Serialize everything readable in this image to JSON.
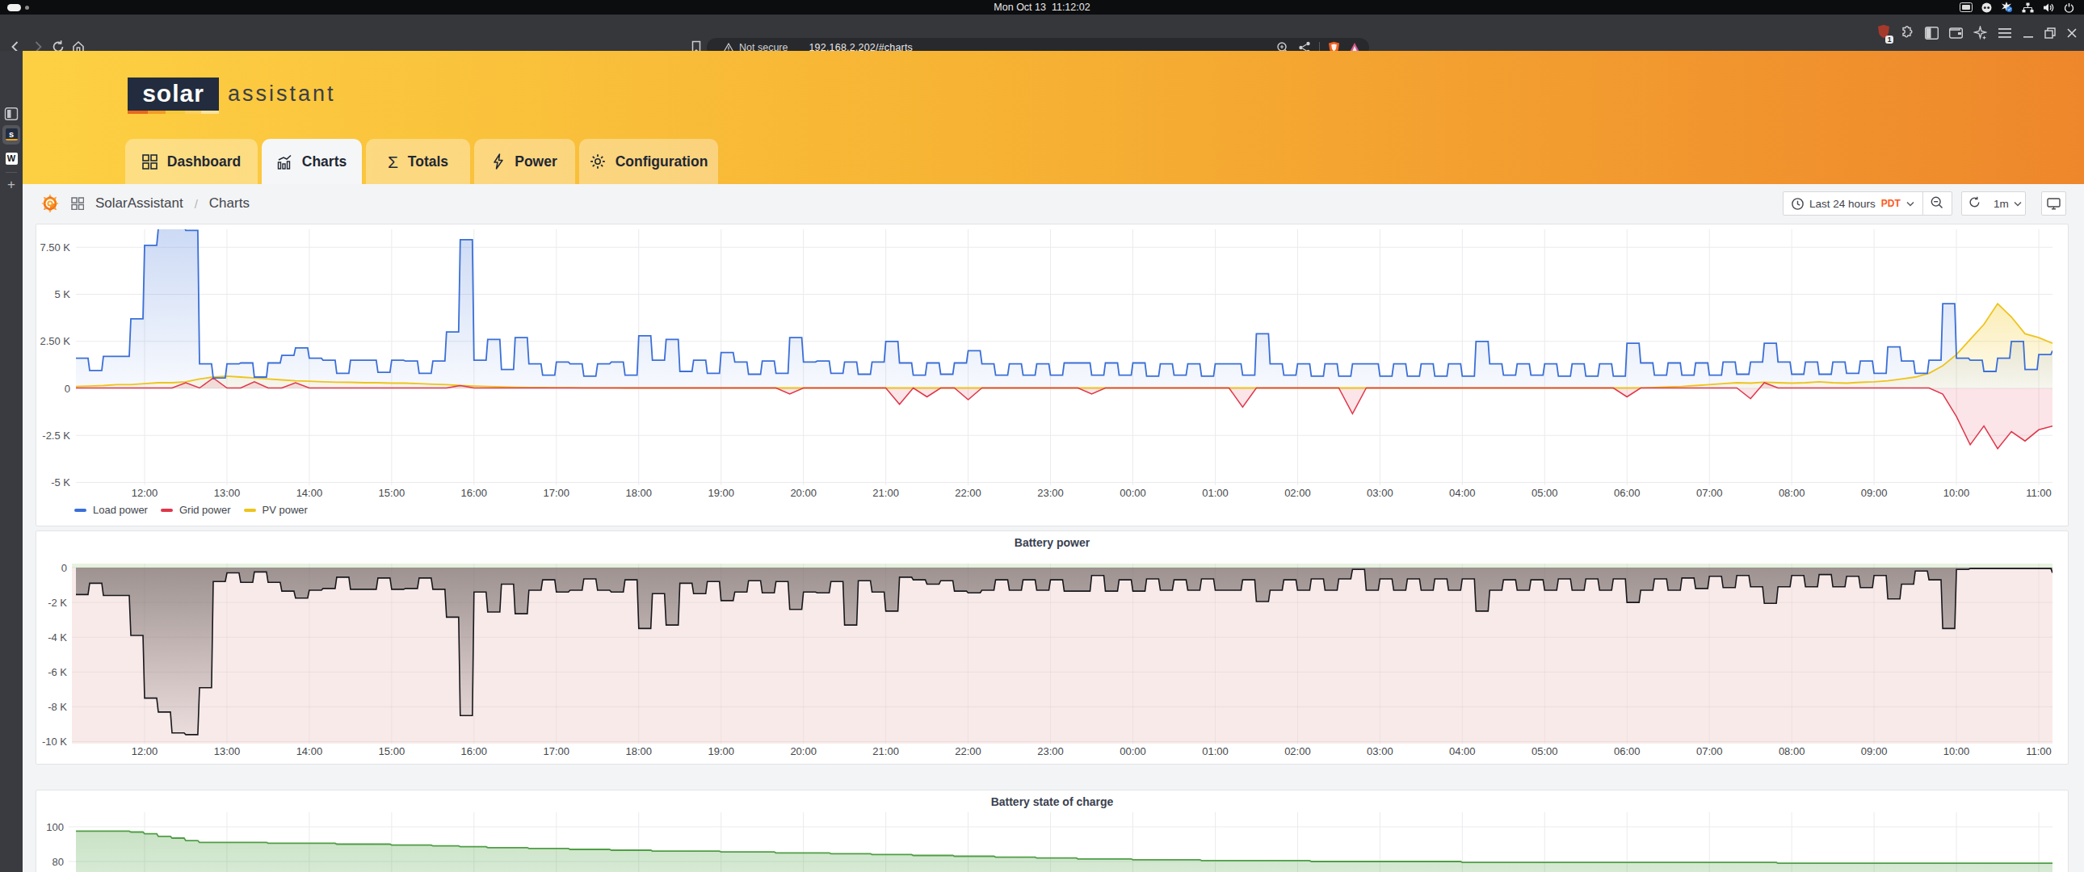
{
  "system_bar": {
    "clock": "Mon Oct 13  11:12:02",
    "tray_icons": [
      "tablet-mode-icon",
      "screencast-icon",
      "input-source-icon",
      "network-wired-icon",
      "volume-icon",
      "power-icon"
    ]
  },
  "browser": {
    "security_label": "Not secure",
    "url": "192.168.2.202/#charts",
    "shield_badge": "1",
    "nav_icons": [
      "back",
      "forward",
      "reload",
      "home"
    ],
    "window_controls": [
      "minimize",
      "maximize",
      "close"
    ]
  },
  "browser_sidebar": {
    "tabs": [
      "solarassistant-tab",
      "wikipedia-tab"
    ],
    "add_label": "+"
  },
  "app": {
    "logo_primary": "solar",
    "logo_secondary": "assistant",
    "logo_strip_colors": [
      "#e8681b",
      "#f29b23",
      "#f6c937",
      "#fbe39b"
    ],
    "tabs": [
      {
        "label": "Dashboard",
        "icon": "grid-icon",
        "active": false
      },
      {
        "label": "Charts",
        "icon": "chart-icon",
        "active": true
      },
      {
        "label": "Totals",
        "icon": "sigma-icon",
        "active": false
      },
      {
        "label": "Power",
        "icon": "lightning-icon",
        "active": false
      },
      {
        "label": "Configuration",
        "icon": "gear-icon",
        "active": false
      }
    ]
  },
  "grafana": {
    "breadcrumb": {
      "root": "SolarAssistant",
      "separator": "/",
      "current": "Charts"
    },
    "toolbar": {
      "time_range": "Last 24 hours",
      "timezone": "PDT",
      "refresh_interval": "1m"
    }
  },
  "chart_data": [
    {
      "type": "area",
      "title": "",
      "unit": "kW",
      "interval_minutes": 10,
      "x_start_clock": "11:10",
      "x_tick_labels": [
        "12:00",
        "13:00",
        "14:00",
        "15:00",
        "16:00",
        "17:00",
        "18:00",
        "19:00",
        "20:00",
        "21:00",
        "22:00",
        "23:00",
        "00:00",
        "01:00",
        "02:00",
        "03:00",
        "04:00",
        "05:00",
        "06:00",
        "07:00",
        "08:00",
        "09:00",
        "10:00",
        "11:00"
      ],
      "y_ticks": [
        {
          "label": "7.50 K",
          "value": 7.5
        },
        {
          "label": "5 K",
          "value": 5
        },
        {
          "label": "2.50 K",
          "value": 2.5
        },
        {
          "label": "0",
          "value": 0
        },
        {
          "label": "-2.5 K",
          "value": -2.5
        },
        {
          "label": "-5 K",
          "value": -5
        }
      ],
      "ylim": [
        -5.6,
        8.45
      ],
      "legend_position": "bottom",
      "series": [
        {
          "name": "Load power",
          "color": "#3a6fd8",
          "fill_from": 0.28,
          "fill_to": 0.05,
          "step": true,
          "values": [
            1.6,
            0.95,
            1.7,
            1.7,
            3.7,
            7.6,
            8.5,
            8.6,
            8.4,
            1.3,
            0.55,
            1.3,
            1.35,
            0.6,
            1.35,
            1.75,
            2.15,
            1.6,
            1.5,
            0.8,
            1.5,
            1.5,
            0.85,
            1.5,
            1.45,
            0.8,
            1.45,
            3.0,
            7.9,
            1.5,
            2.6,
            1.0,
            2.7,
            1.3,
            0.7,
            1.4,
            1.3,
            0.65,
            1.3,
            1.4,
            0.7,
            2.8,
            1.5,
            2.6,
            0.9,
            1.5,
            0.8,
            1.9,
            1.4,
            0.75,
            1.45,
            0.8,
            2.7,
            1.4,
            1.45,
            0.8,
            1.4,
            0.75,
            1.4,
            2.5,
            1.35,
            0.7,
            1.35,
            0.75,
            1.35,
            2.0,
            1.3,
            0.7,
            1.3,
            0.7,
            1.3,
            0.7,
            1.35,
            1.35,
            0.7,
            1.35,
            0.7,
            1.35,
            0.65,
            1.3,
            0.7,
            1.3,
            0.65,
            1.3,
            1.3,
            0.7,
            2.9,
            1.3,
            0.7,
            1.3,
            0.65,
            1.3,
            0.65,
            1.3,
            1.3,
            0.65,
            1.3,
            0.65,
            1.3,
            0.65,
            1.3,
            0.65,
            2.5,
            1.3,
            0.7,
            1.3,
            0.7,
            1.3,
            0.65,
            1.3,
            0.65,
            1.3,
            0.65,
            2.4,
            1.35,
            0.7,
            1.35,
            0.7,
            1.35,
            0.7,
            1.4,
            0.75,
            1.4,
            2.4,
            1.4,
            0.75,
            1.4,
            0.75,
            1.4,
            0.8,
            1.45,
            0.8,
            2.2,
            1.45,
            0.8,
            1.5,
            4.5,
            1.6,
            1.5,
            0.9,
            1.6,
            2.5,
            1.0,
            1.8,
            2.0
          ]
        },
        {
          "name": "Grid power",
          "color": "#e0364a",
          "fill_from": 0.14,
          "fill_to": 0.14,
          "step": false,
          "values": [
            0.02,
            0.02,
            0.02,
            0.02,
            0.02,
            0.02,
            0.02,
            0.02,
            0.3,
            0.02,
            0.55,
            0.02,
            0.02,
            0.35,
            0.02,
            0.02,
            0.3,
            0.02,
            0.02,
            0.02,
            0.02,
            0.02,
            0.02,
            0.02,
            0.02,
            0.02,
            0.02,
            0.02,
            0.15,
            0.02,
            0.02,
            0.02,
            0.02,
            0.02,
            0.02,
            0.02,
            0.02,
            0.02,
            0.02,
            0.02,
            0.02,
            0.02,
            0.02,
            0.02,
            0.02,
            0.02,
            0.02,
            0.02,
            0.02,
            0.02,
            0.02,
            0.02,
            -0.3,
            0.02,
            0.02,
            0.02,
            0.02,
            0.02,
            0.02,
            0.02,
            -0.85,
            0.02,
            -0.45,
            0.02,
            0.02,
            -0.6,
            0.02,
            0.02,
            0.02,
            0.02,
            0.02,
            0.02,
            0.02,
            0.02,
            -0.3,
            0.02,
            0.02,
            0.02,
            0.02,
            0.02,
            0.02,
            0.02,
            0.02,
            0.02,
            0.02,
            -1.0,
            0.02,
            0.02,
            0.02,
            0.02,
            0.02,
            0.02,
            0.02,
            -1.35,
            0.02,
            0.02,
            0.02,
            0.02,
            0.02,
            0.02,
            0.02,
            0.02,
            0.02,
            0.02,
            0.02,
            0.02,
            0.02,
            0.02,
            0.02,
            0.02,
            0.02,
            0.02,
            0.02,
            -0.45,
            0.02,
            0.02,
            0.02,
            0.02,
            0.02,
            0.02,
            0.02,
            0.02,
            -0.55,
            0.3,
            0.02,
            0.02,
            0.02,
            0.02,
            0.02,
            0.02,
            0.02,
            0.02,
            0.02,
            0.02,
            0.02,
            0.02,
            -0.3,
            -1.5,
            -3.0,
            -2.0,
            -3.2,
            -2.3,
            -2.8,
            -2.2,
            -2.0
          ]
        },
        {
          "name": "PV power",
          "color": "#eec41c",
          "fill_from": 0.3,
          "fill_to": 0.07,
          "step": false,
          "values": [
            0.1,
            0.12,
            0.15,
            0.2,
            0.2,
            0.25,
            0.3,
            0.3,
            0.35,
            0.5,
            0.6,
            0.65,
            0.6,
            0.55,
            0.5,
            0.45,
            0.4,
            0.38,
            0.35,
            0.33,
            0.32,
            0.3,
            0.3,
            0.28,
            0.28,
            0.25,
            0.22,
            0.2,
            0.15,
            0.12,
            0.1,
            0.08,
            0.06,
            0.05,
            0.05,
            0.04,
            0.04,
            0.03,
            0.03,
            0.03,
            0.02,
            0.02,
            0.02,
            0.02,
            0.02,
            0.02,
            0.02,
            0.02,
            0.02,
            0.02,
            0.02,
            0.02,
            0.02,
            0.02,
            0.02,
            0.02,
            0.02,
            0.02,
            0.02,
            0.02,
            0.02,
            0.02,
            0.02,
            0.02,
            0.02,
            0.02,
            0.02,
            0.02,
            0.02,
            0.02,
            0.02,
            0.02,
            0.02,
            0.02,
            0.02,
            0.02,
            0.02,
            0.02,
            0.02,
            0.02,
            0.02,
            0.02,
            0.02,
            0.02,
            0.02,
            0.02,
            0.02,
            0.02,
            0.02,
            0.02,
            0.02,
            0.02,
            0.02,
            0.02,
            0.02,
            0.02,
            0.02,
            0.02,
            0.02,
            0.02,
            0.02,
            0.02,
            0.02,
            0.02,
            0.02,
            0.02,
            0.02,
            0.02,
            0.02,
            0.02,
            0.02,
            0.02,
            0.02,
            0.02,
            0.03,
            0.05,
            0.08,
            0.1,
            0.15,
            0.2,
            0.25,
            0.3,
            0.28,
            0.33,
            0.3,
            0.28,
            0.3,
            0.35,
            0.3,
            0.28,
            0.32,
            0.35,
            0.4,
            0.5,
            0.6,
            0.8,
            1.2,
            1.8,
            2.6,
            3.4,
            4.5,
            3.8,
            2.9,
            2.7,
            2.4
          ]
        }
      ]
    },
    {
      "type": "area",
      "title": "Battery power",
      "unit": "kW",
      "interval_minutes": 10,
      "x_tick_labels": [
        "12:00",
        "13:00",
        "14:00",
        "15:00",
        "16:00",
        "17:00",
        "18:00",
        "19:00",
        "20:00",
        "21:00",
        "22:00",
        "23:00",
        "00:00",
        "01:00",
        "02:00",
        "03:00",
        "04:00",
        "05:00",
        "06:00",
        "07:00",
        "08:00",
        "09:00",
        "10:00",
        "11:00"
      ],
      "y_ticks": [
        {
          "label": "0",
          "value": 0
        },
        {
          "label": "-2 K",
          "value": -2
        },
        {
          "label": "-4 K",
          "value": -4
        },
        {
          "label": "-6 K",
          "value": -6
        },
        {
          "label": "-8 K",
          "value": -8
        },
        {
          "label": "-10 K",
          "value": -10
        }
      ],
      "ylim": [
        -10.3,
        0.25
      ],
      "series": [
        {
          "name": "Battery power",
          "color": "#17181c",
          "step": true,
          "values": [
            -1.55,
            -0.9,
            -1.6,
            -1.6,
            -3.9,
            -7.5,
            -8.3,
            -9.5,
            -9.6,
            -6.9,
            -0.8,
            -0.3,
            -0.85,
            -0.25,
            -0.85,
            -1.35,
            -1.75,
            -1.3,
            -1.2,
            -0.55,
            -1.25,
            -1.25,
            -0.6,
            -1.25,
            -1.2,
            -0.6,
            -1.25,
            -2.85,
            -8.5,
            -1.4,
            -2.55,
            -0.95,
            -2.65,
            -1.3,
            -0.7,
            -1.4,
            -1.3,
            -0.65,
            -1.3,
            -1.4,
            -0.7,
            -3.5,
            -1.5,
            -3.3,
            -0.9,
            -1.5,
            -0.8,
            -1.9,
            -1.4,
            -0.75,
            -1.45,
            -0.8,
            -2.4,
            -1.4,
            -1.45,
            -0.8,
            -3.3,
            -0.75,
            -1.4,
            -2.5,
            -0.55,
            -0.7,
            -0.95,
            -0.75,
            -1.35,
            -1.45,
            -1.3,
            -0.7,
            -1.3,
            -0.7,
            -1.3,
            -0.7,
            -1.35,
            -1.35,
            -0.45,
            -1.35,
            -0.7,
            -1.35,
            -0.65,
            -1.3,
            -0.7,
            -1.3,
            -0.65,
            -1.3,
            -1.3,
            -0.7,
            -1.95,
            -1.3,
            -0.7,
            -1.3,
            -0.65,
            -1.3,
            -0.65,
            -0.1,
            -1.3,
            -0.65,
            -1.3,
            -0.65,
            -1.3,
            -0.65,
            -1.3,
            -0.65,
            -2.5,
            -1.3,
            -0.7,
            -1.3,
            -0.7,
            -1.3,
            -0.65,
            -1.3,
            -0.65,
            -1.3,
            -0.65,
            -2.0,
            -1.3,
            -0.65,
            -1.3,
            -0.6,
            -1.2,
            -0.5,
            -1.15,
            -0.45,
            -1.1,
            -2.05,
            -1.1,
            -0.45,
            -1.1,
            -0.4,
            -1.1,
            -0.5,
            -1.15,
            -0.45,
            -1.8,
            -0.95,
            -0.2,
            -0.7,
            -3.5,
            -0.1,
            -0.05,
            -0.05,
            -0.05,
            -0.05,
            -0.05,
            -0.05,
            -0.3
          ]
        }
      ],
      "negative_region_color": "#f9eaea",
      "positive_region_color": "#e7f2e0"
    },
    {
      "type": "area",
      "title": "Battery state of charge",
      "unit": "%",
      "y_ticks": [
        {
          "label": "100",
          "value": 100
        },
        {
          "label": "80",
          "value": 80
        }
      ],
      "series": [
        {
          "name": "Battery state of charge",
          "color": "#4f9e45",
          "points": [
            [
              0,
              97.5
            ],
            [
              0.5,
              97.5
            ],
            [
              0.8,
              96.5
            ],
            [
              1.4,
              91.2
            ],
            [
              2.2,
              90.8
            ],
            [
              3.2,
              90.2
            ],
            [
              4.2,
              89.3
            ],
            [
              4.9,
              88.2
            ],
            [
              6,
              87.2
            ],
            [
              7,
              86.2
            ],
            [
              8,
              85.6
            ],
            [
              9,
              84.8
            ],
            [
              10,
              83.8
            ],
            [
              11,
              82.8
            ],
            [
              12,
              81.8
            ],
            [
              13,
              81.0
            ],
            [
              14,
              80.6
            ],
            [
              15,
              80.2
            ],
            [
              16,
              79.9
            ],
            [
              17,
              79.7
            ],
            [
              18,
              79.5
            ],
            [
              19,
              79.4
            ],
            [
              20,
              79.3
            ],
            [
              21,
              79.2
            ],
            [
              22,
              79.1
            ],
            [
              23,
              79.0
            ],
            [
              24,
              79.0
            ]
          ]
        }
      ]
    }
  ]
}
